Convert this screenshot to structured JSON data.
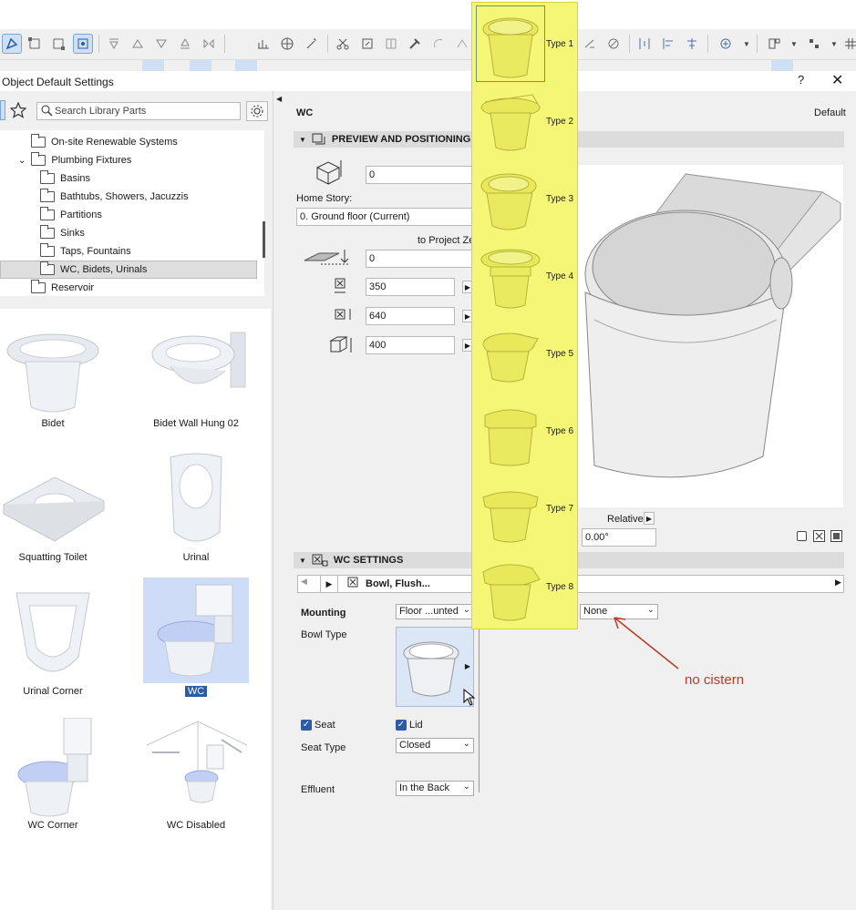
{
  "dialog": {
    "title": "Object Default Settings",
    "help": "?",
    "close": "✕"
  },
  "library": {
    "search_placeholder": "Search Library Parts",
    "tree": [
      {
        "label": "On-site Renewable Systems"
      },
      {
        "label": "Plumbing Fixtures"
      },
      {
        "label": "Basins"
      },
      {
        "label": "Bathtubs, Showers, Jacuzzis"
      },
      {
        "label": "Partitions"
      },
      {
        "label": "Sinks"
      },
      {
        "label": "Taps, Fountains"
      },
      {
        "label": "WC, Bidets, Urinals"
      },
      {
        "label": "Reservoir"
      }
    ],
    "items": [
      {
        "label": "Bidet"
      },
      {
        "label": "Bidet Wall Hung 02"
      },
      {
        "label": "Squatting Toilet"
      },
      {
        "label": "Urinal"
      },
      {
        "label": "Urinal Corner"
      },
      {
        "label": "WC"
      },
      {
        "label": "WC Corner"
      },
      {
        "label": "WC Disabled"
      }
    ]
  },
  "settings": {
    "object_name": "WC",
    "default_label": "Default",
    "preview_section": "PREVIEW AND POSITIONING",
    "elevation_value": "0",
    "home_story_label": "Home Story:",
    "home_story_value": "0. Ground floor (Current)",
    "to_project_zero": "to Project Zer",
    "project_zero_value": "0",
    "width_value": "350",
    "length_value": "640",
    "height_value": "400",
    "relative_label": "Relative",
    "angle_value": "0.00°",
    "wc_section": "WC SETTINGS",
    "page_value": "Bowl, Flush...",
    "mounting_label": "Mounting",
    "mounting_value": "Floor ...unted",
    "cistern_value": "None",
    "bowl_type_label": "Bowl Type",
    "seat_label": "Seat",
    "lid_label": "Lid",
    "seat_type_label": "Seat Type",
    "seat_type_value": "Closed",
    "effluent_label": "Effluent",
    "effluent_value": "In the Back"
  },
  "bowl_types": [
    {
      "label": "Type 1"
    },
    {
      "label": "Type 2"
    },
    {
      "label": "Type 3"
    },
    {
      "label": "Type 4"
    },
    {
      "label": "Type 5"
    },
    {
      "label": "Type 6"
    },
    {
      "label": "Type 7"
    },
    {
      "label": "Type 8"
    }
  ],
  "annotation": {
    "text": "no cistern",
    "color": "#c0392b"
  },
  "colors": {
    "highlight": "#f6f676",
    "accent": "#2b5aa6",
    "selection": "#cfe0f5"
  }
}
